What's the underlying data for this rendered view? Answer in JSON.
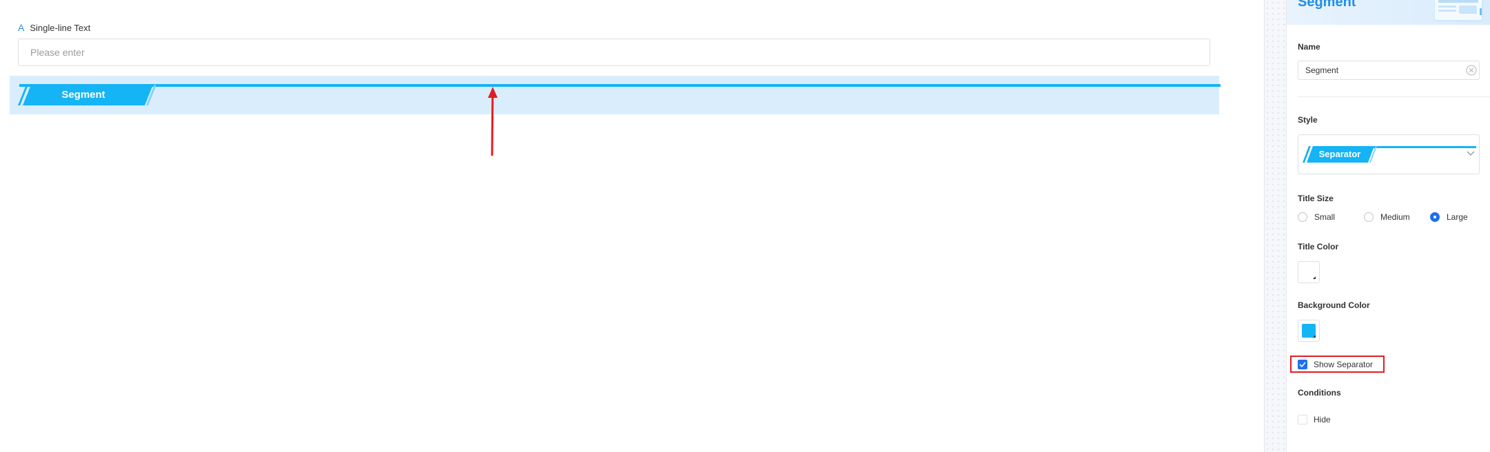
{
  "canvas": {
    "field_label": "Single-line Text",
    "field_icon": "text-type-icon",
    "input_placeholder": "Please enter",
    "segment_title": "Segment"
  },
  "panel": {
    "header_title": "Segment",
    "name_label": "Name",
    "name_value": "Segment",
    "style_label": "Style",
    "style_value": "Separator",
    "title_size_label": "Title Size",
    "title_size_options": [
      {
        "label": "Small",
        "selected": false
      },
      {
        "label": "Medium",
        "selected": false
      },
      {
        "label": "Large",
        "selected": true
      }
    ],
    "title_color_label": "Title Color",
    "title_color": "#ffffff",
    "background_color_label": "Background Color",
    "background_color": "#14b4f5",
    "show_separator_label": "Show Separator",
    "show_separator_checked": true,
    "conditions_label": "Conditions",
    "hide_label": "Hide",
    "hide_checked": false
  },
  "colors": {
    "accent": "#14b4f5",
    "primary": "#1f6ff0",
    "segment_background": "#d9edfd",
    "annotation": "#e11d24"
  }
}
